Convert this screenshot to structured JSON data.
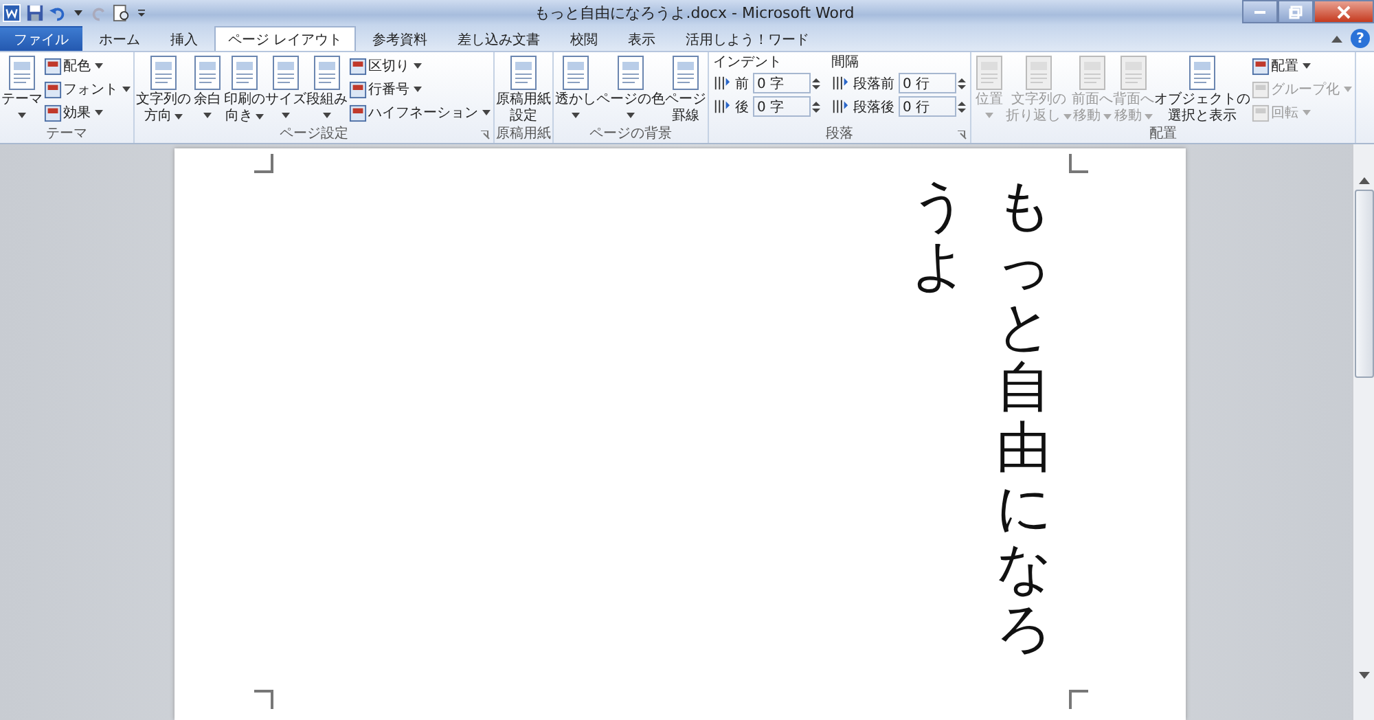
{
  "window": {
    "title": "もっと自由になろうよ.docx - Microsoft Word",
    "help": "?"
  },
  "tabs": [
    {
      "label": "ファイル",
      "kind": "file",
      "selected": false
    },
    {
      "label": "ホーム",
      "kind": "tab",
      "selected": false
    },
    {
      "label": "挿入",
      "kind": "tab",
      "selected": false
    },
    {
      "label": "ページ レイアウト",
      "kind": "tab",
      "selected": true
    },
    {
      "label": "参考資料",
      "kind": "tab",
      "selected": false
    },
    {
      "label": "差し込み文書",
      "kind": "tab",
      "selected": false
    },
    {
      "label": "校閲",
      "kind": "tab",
      "selected": false
    },
    {
      "label": "表示",
      "kind": "tab",
      "selected": false
    },
    {
      "label": "活用しよう！ワード",
      "kind": "tab",
      "selected": false
    }
  ],
  "ribbon_groups": [
    {
      "label": "テーマ",
      "launcher": false,
      "items": [
        {
          "kind": "large",
          "lines": [
            "テーマ"
          ],
          "dropdown": true,
          "disabled": false
        },
        {
          "kind": "stack",
          "items": [
            {
              "label": "配色",
              "dropdown": true,
              "disabled": false
            },
            {
              "label": "フォント",
              "dropdown": true,
              "disabled": false
            },
            {
              "label": "効果",
              "dropdown": true,
              "disabled": false
            }
          ]
        }
      ]
    },
    {
      "label": "ページ設定",
      "launcher": true,
      "items": [
        {
          "kind": "large",
          "lines": [
            "文字列の",
            "方向"
          ],
          "dropdown": true,
          "disabled": false
        },
        {
          "kind": "large",
          "lines": [
            "余白"
          ],
          "dropdown": true,
          "disabled": false
        },
        {
          "kind": "large",
          "lines": [
            "印刷の",
            "向き"
          ],
          "dropdown": true,
          "disabled": false
        },
        {
          "kind": "large",
          "lines": [
            "サイズ"
          ],
          "dropdown": true,
          "disabled": false
        },
        {
          "kind": "large",
          "lines": [
            "段組み"
          ],
          "dropdown": true,
          "disabled": false
        },
        {
          "kind": "stack",
          "items": [
            {
              "label": "区切り",
              "dropdown": true,
              "disabled": false
            },
            {
              "label": "行番号",
              "dropdown": true,
              "disabled": false
            },
            {
              "label": "ハイフネーション",
              "dropdown": true,
              "disabled": false
            }
          ]
        }
      ]
    },
    {
      "label": "原稿用紙",
      "launcher": false,
      "items": [
        {
          "kind": "large",
          "lines": [
            "原稿用紙",
            "設定"
          ],
          "dropdown": false,
          "disabled": false
        }
      ]
    },
    {
      "label": "ページの背景",
      "launcher": false,
      "items": [
        {
          "kind": "large",
          "lines": [
            "透かし"
          ],
          "dropdown": true,
          "disabled": false
        },
        {
          "kind": "large",
          "lines": [
            "ページの色"
          ],
          "dropdown": true,
          "disabled": false
        },
        {
          "kind": "large",
          "lines": [
            "ページ",
            "罫線"
          ],
          "dropdown": false,
          "disabled": false
        }
      ]
    },
    {
      "label": "段落",
      "launcher": true,
      "items": [
        {
          "kind": "fields",
          "heading": "インデント",
          "rows": [
            {
              "label": "前",
              "value": "0 字"
            },
            {
              "label": "後",
              "value": "0 字"
            }
          ]
        },
        {
          "kind": "fields",
          "heading": "間隔",
          "rows": [
            {
              "label": "段落前",
              "value": "0 行"
            },
            {
              "label": "段落後",
              "value": "0 行"
            }
          ]
        }
      ]
    },
    {
      "label": "配置",
      "launcher": false,
      "items": [
        {
          "kind": "large",
          "lines": [
            "位置"
          ],
          "dropdown": true,
          "disabled": true
        },
        {
          "kind": "large",
          "lines": [
            "文字列の",
            "折り返し"
          ],
          "dropdown": true,
          "disabled": true
        },
        {
          "kind": "large",
          "lines": [
            "前面へ",
            "移動"
          ],
          "dropdown": true,
          "disabled": true
        },
        {
          "kind": "large",
          "lines": [
            "背面へ",
            "移動"
          ],
          "dropdown": true,
          "disabled": true
        },
        {
          "kind": "large",
          "lines": [
            "オブジェクトの",
            "選択と表示"
          ],
          "dropdown": false,
          "disabled": false
        },
        {
          "kind": "stack",
          "items": [
            {
              "label": "配置",
              "dropdown": true,
              "disabled": false
            },
            {
              "label": "グループ化",
              "dropdown": true,
              "disabled": true
            },
            {
              "label": "回転",
              "dropdown": true,
              "disabled": true
            }
          ]
        }
      ]
    }
  ],
  "document": {
    "columns": [
      "うよ",
      "もっと自由になろ"
    ]
  }
}
